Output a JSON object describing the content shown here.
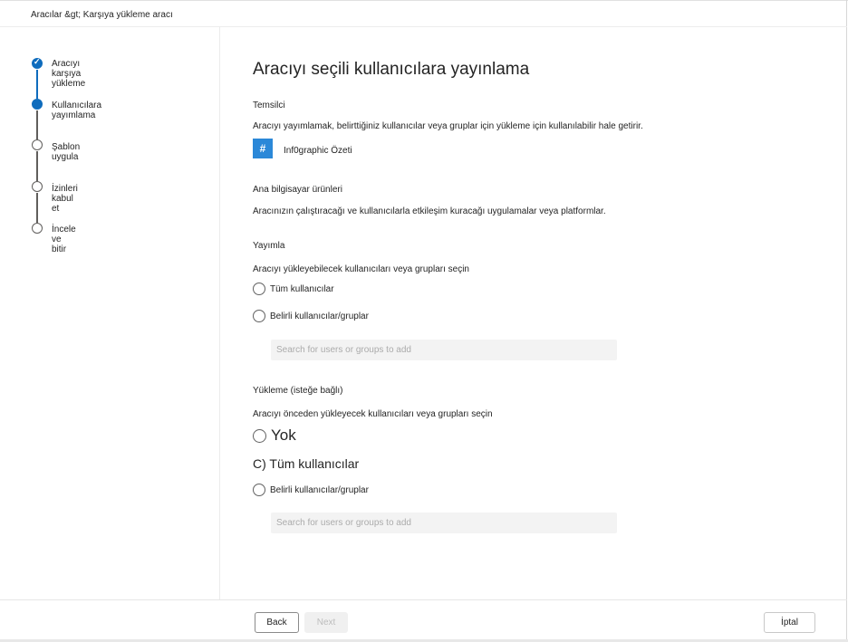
{
  "breadcrumb": "Aracılar &gt; Karşıya yükleme aracı",
  "steps": [
    {
      "label": "Aracıyı karşıya yükleme",
      "state": "done"
    },
    {
      "label": "Kullanıcılara yayımlama",
      "state": "current"
    },
    {
      "label": "Şablon uygula",
      "state": "pending"
    },
    {
      "label": "İzinleri kabul et",
      "state": "pending"
    },
    {
      "label": "İncele ve bitir",
      "state": "pending"
    }
  ],
  "main": {
    "title": "Aracıyı seçili kullanıcılara yayınlama",
    "agent": {
      "heading": "Temsilci",
      "description": "Aracıyı yayımlamak, belirttiğiniz kullanıcılar veya gruplar için yükleme için kullanılabilir hale getirir.",
      "icon_glyph": "#",
      "name": "Inf0graphic Özeti"
    },
    "host": {
      "heading": "Ana bilgisayar ürünleri",
      "description": "Aracınızın çalıştıracağı ve kullanıcılarla etkileşim kuracağı uygulamalar veya platformlar."
    },
    "publish": {
      "heading": "Yayımla",
      "description": "Aracıyı yükleyebilecek kullanıcıları veya grupları seçin",
      "option_all": "Tüm kullanıcılar",
      "option_specific": "Belirli kullanıcılar/gruplar",
      "search_placeholder": "Search for users or groups to add"
    },
    "install": {
      "heading": "Yükleme (isteğe bağlı)",
      "description": "Aracıyı önceden yükleyecek kullanıcıları veya grupları seçin",
      "option_none": "Yok",
      "option_all": "C) Tüm kullanıcılar",
      "option_specific": "Belirli kullanıcılar/gruplar",
      "search_placeholder": "Search for users or groups to add"
    }
  },
  "footer": {
    "back_label": "Back",
    "next_label": "Next",
    "cancel_label": "İptal"
  },
  "colors": {
    "accent": "#0f6cbd",
    "agent_icon": "#2b88d8"
  }
}
